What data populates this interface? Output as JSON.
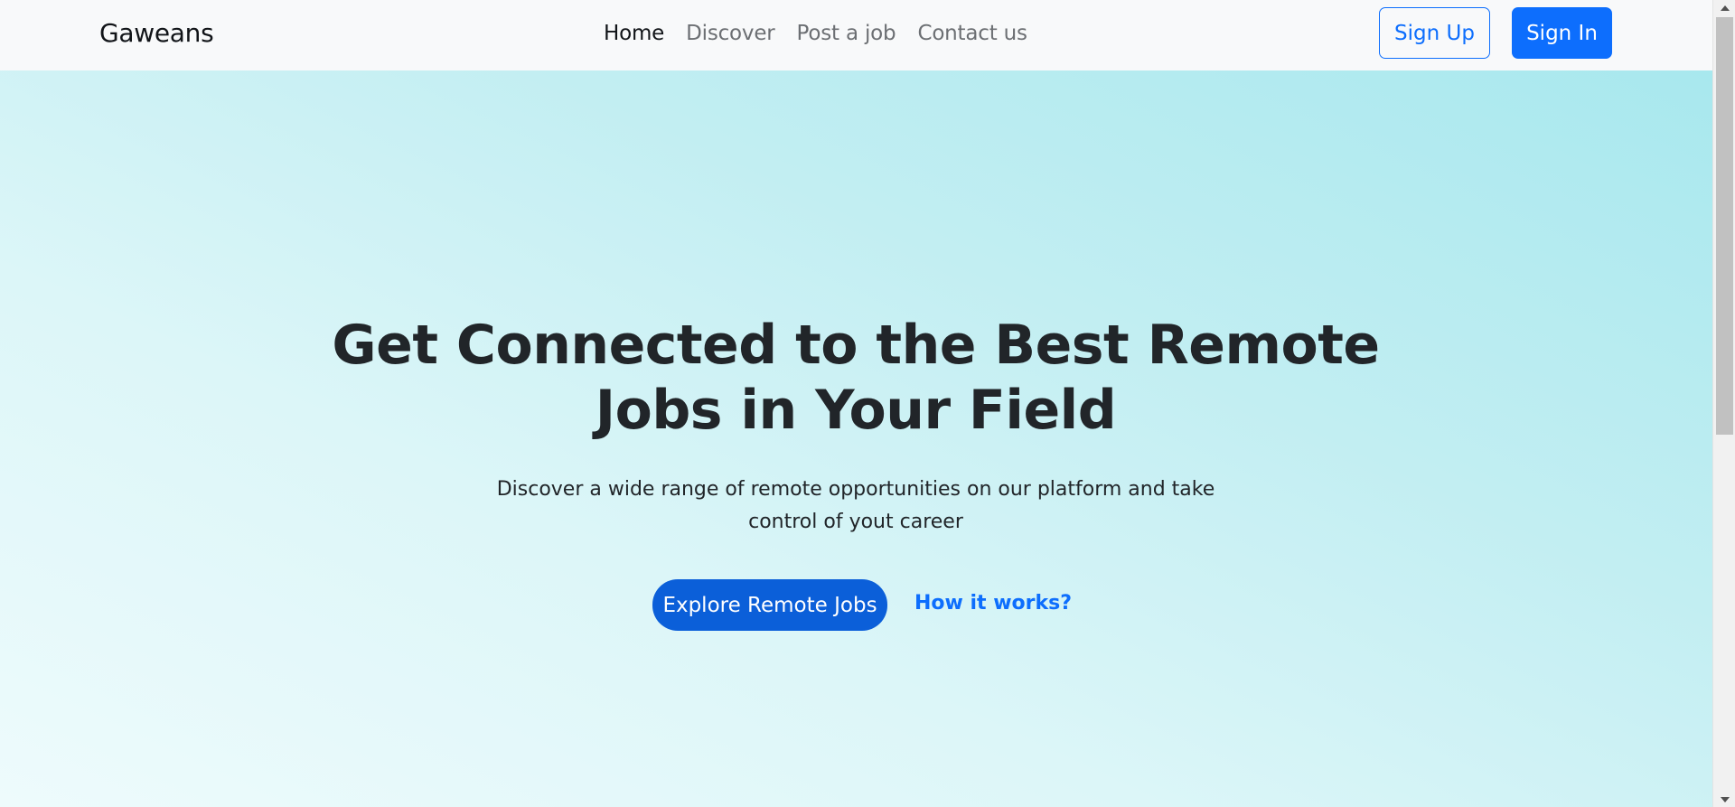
{
  "navbar": {
    "brand": "Gaweans",
    "links": [
      {
        "label": "Home",
        "active": true
      },
      {
        "label": "Discover",
        "active": false
      },
      {
        "label": "Post a job",
        "active": false
      },
      {
        "label": "Contact us",
        "active": false
      }
    ],
    "sign_up_label": "Sign Up",
    "sign_in_label": "Sign In"
  },
  "hero": {
    "title": "Get Connected to the Best Remote Jobs in Your Field",
    "subtitle": "Discover a wide range of remote opportunities on our platform and take control of yout career",
    "primary_cta": "Explore Remote Jobs",
    "secondary_cta": "How it works?"
  },
  "colors": {
    "primary": "#0d6efd",
    "navbar_bg": "#f8f9fa",
    "hero_gradient_start": "#a8e8ee",
    "hero_gradient_end": "#eefbfc",
    "text_dark": "#212529"
  },
  "icons": {
    "scroll_up": "triangle-up-icon",
    "scroll_down": "triangle-down-icon"
  }
}
